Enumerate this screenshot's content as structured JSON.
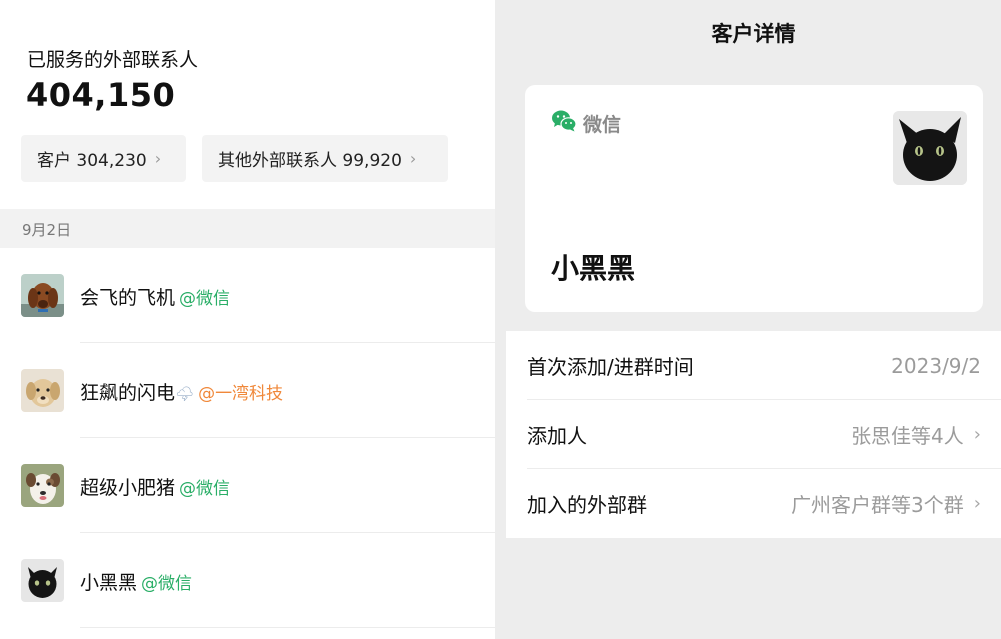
{
  "left": {
    "summary_label": "已服务的外部联系人",
    "summary_total": "404,150",
    "chips": [
      {
        "label": "客户 304,230",
        "icon": "chevron-right-icon"
      },
      {
        "label": "其他外部联系人 99,920",
        "icon": "chevron-right-icon"
      }
    ],
    "date": "9月2日",
    "contacts": [
      {
        "name": "会飞的飞机",
        "tag": "@微信",
        "tag_color": "#2aae67",
        "avatar": "dog-avatar"
      },
      {
        "name": "狂飙的闪电",
        "emoji": "🌩",
        "tag": "@一湾科技",
        "tag_color": "#f0883a",
        "avatar": "labrador-avatar"
      },
      {
        "name": "超级小肥猪",
        "tag": "@微信",
        "tag_color": "#2aae67",
        "avatar": "white-dog-avatar"
      },
      {
        "name": "小黑黑",
        "tag": "@微信",
        "tag_color": "#2aae67",
        "avatar": "black-cat-avatar"
      }
    ]
  },
  "right": {
    "title": "客户详情",
    "card": {
      "source_label": "微信",
      "source_icon": "wechat-icon",
      "source_color": "#2aae67",
      "name": "小黑黑",
      "avatar": "black-cat-avatar"
    },
    "rows": [
      {
        "label": "首次添加/进群时间",
        "value": "2023/9/2",
        "chevron": false
      },
      {
        "label": "添加人",
        "value": "张思佳等4人",
        "chevron": true
      },
      {
        "label": "加入的外部群",
        "value": "广州客户群等3个群",
        "chevron": true
      }
    ]
  }
}
